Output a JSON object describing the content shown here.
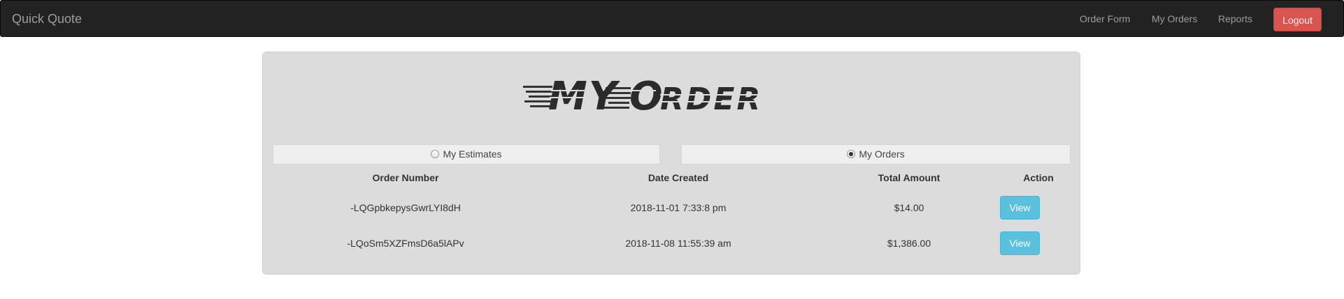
{
  "navbar": {
    "brand": "Quick Quote",
    "links": [
      "Order Form",
      "My Orders",
      "Reports"
    ],
    "logout_label": "Logout"
  },
  "logo": {
    "text": "MyOrder"
  },
  "toggle": {
    "estimates_label": "My Estimates",
    "orders_label": "My Orders",
    "selected": "My Orders"
  },
  "table": {
    "headers": [
      "Order Number",
      "Date Created",
      "Total Amount",
      "Action"
    ],
    "rows": [
      {
        "order_number": "-LQGpbkepysGwrLYI8dH",
        "date_created": "2018-11-01 7:33:8 pm",
        "total_amount": "$14.00",
        "action_label": "View"
      },
      {
        "order_number": "-LQoSm5XZFmsD6a5lAPv",
        "date_created": "2018-11-08 11:55:39 am",
        "total_amount": "$1,386.00",
        "action_label": "View"
      }
    ]
  },
  "colors": {
    "navbar_bg": "#222222",
    "logout": "#d9534f",
    "view_button": "#5bc0de",
    "panel_bg": "#dcdcdc"
  }
}
